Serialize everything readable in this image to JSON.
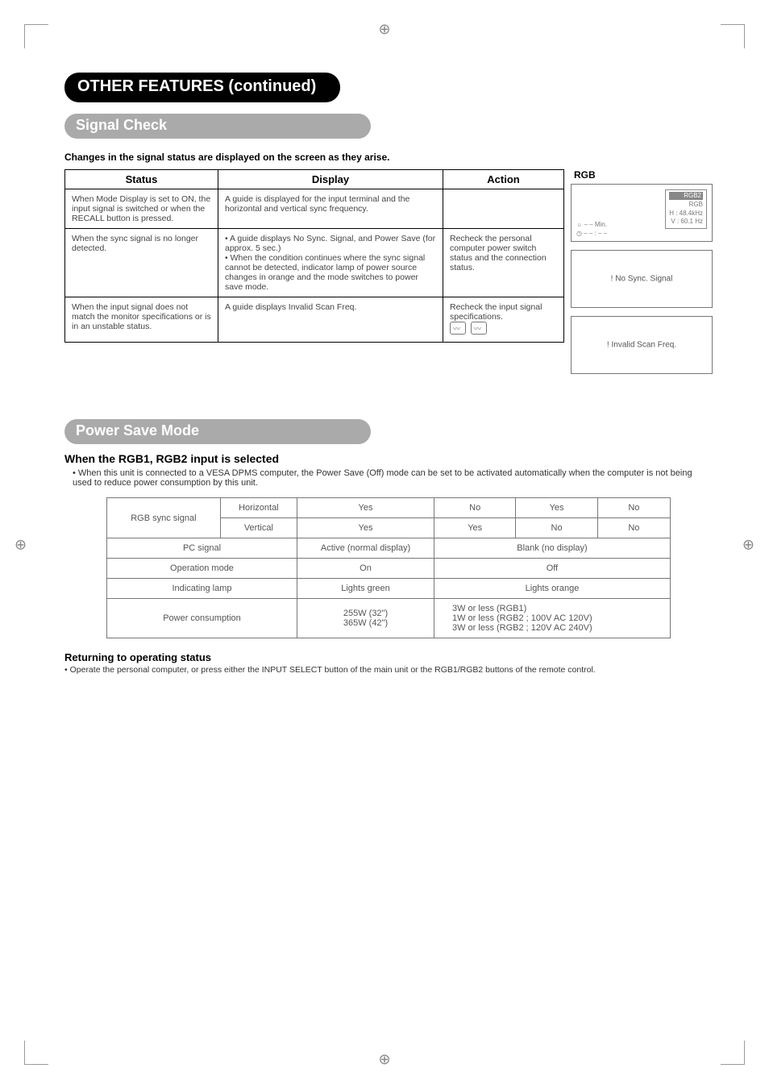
{
  "header": {
    "title": "OTHER FEATURES (continued)",
    "signal_check": "Signal Check",
    "changes_line": "Changes in the signal status are displayed on the screen as they arise."
  },
  "status_table": {
    "head_status": "Status",
    "head_display": "Display",
    "head_action": "Action",
    "rows": [
      {
        "status": "When Mode Display is set to ON, the input signal is switched or when the RECALL button is pressed.",
        "display": "A guide is displayed for the input terminal and the horizontal and vertical sync frequency.",
        "action": ""
      },
      {
        "status": "When the sync signal is no longer detected.",
        "display": "• A guide displays No Sync. Signal, and Power Save (for approx. 5 sec.)\n• When the condition continues where the sync signal cannot be detected, indicator lamp of power source changes in orange and the mode switches to power save mode.",
        "action": "Recheck the personal computer power switch status and the connection status."
      },
      {
        "status": "When the input signal does not match the monitor specifications or is in an unstable status.",
        "display": "A guide displays Invalid Scan Freq.",
        "action": "Recheck the input signal specifications."
      }
    ]
  },
  "rgb": {
    "label": "RGB",
    "box1": {
      "l1": "RGB2",
      "l2": "RGB",
      "l3": "H :   48.4kHz",
      "l4": "V :   60.1 Hz",
      "clock1": "– – Min.",
      "clock2": "– – : – –"
    },
    "box2": "! No Sync. Signal",
    "box3": "! Invalid Scan Freq."
  },
  "power_save": {
    "pill": "Power Save Mode",
    "subhead": "When the RGB1, RGB2 input is selected",
    "desc": "• When this unit is connected to a VESA DPMS computer, the Power Save (Off) mode can be set to be activated automatically when the computer is not being used to reduce power consumption by this unit.",
    "table": {
      "r1c1": "RGB sync signal",
      "r1c2": "Horizontal",
      "r1c3": "Yes",
      "r1c4": "No",
      "r1c5": "Yes",
      "r1c6": "No",
      "r2c2": "Vertical",
      "r2c3": "Yes",
      "r2c4": "Yes",
      "r2c5": "No",
      "r2c6": "No",
      "r3c1": "PC signal",
      "r3c2": "Active (normal display)",
      "r3c3": "Blank (no display)",
      "r4c1": "Operation mode",
      "r4c2": "On",
      "r4c3": "Off",
      "r5c1": "Indicating lamp",
      "r5c2": "Lights green",
      "r5c3": "Lights orange",
      "r6c1": "Power consumption",
      "r6c2": "255W (32\")\n365W (42\")",
      "r6c3": "3W or less (RGB1)\n  1W or less (RGB2 ; 100V    AC    120V)\n  3W or less (RGB2 ; 120V    AC    240V)"
    },
    "returning_head": "Returning to operating status",
    "returning_note": "• Operate the personal computer, or press either the INPUT SELECT button of the main unit or the RGB1/RGB2 buttons of the remote control."
  }
}
